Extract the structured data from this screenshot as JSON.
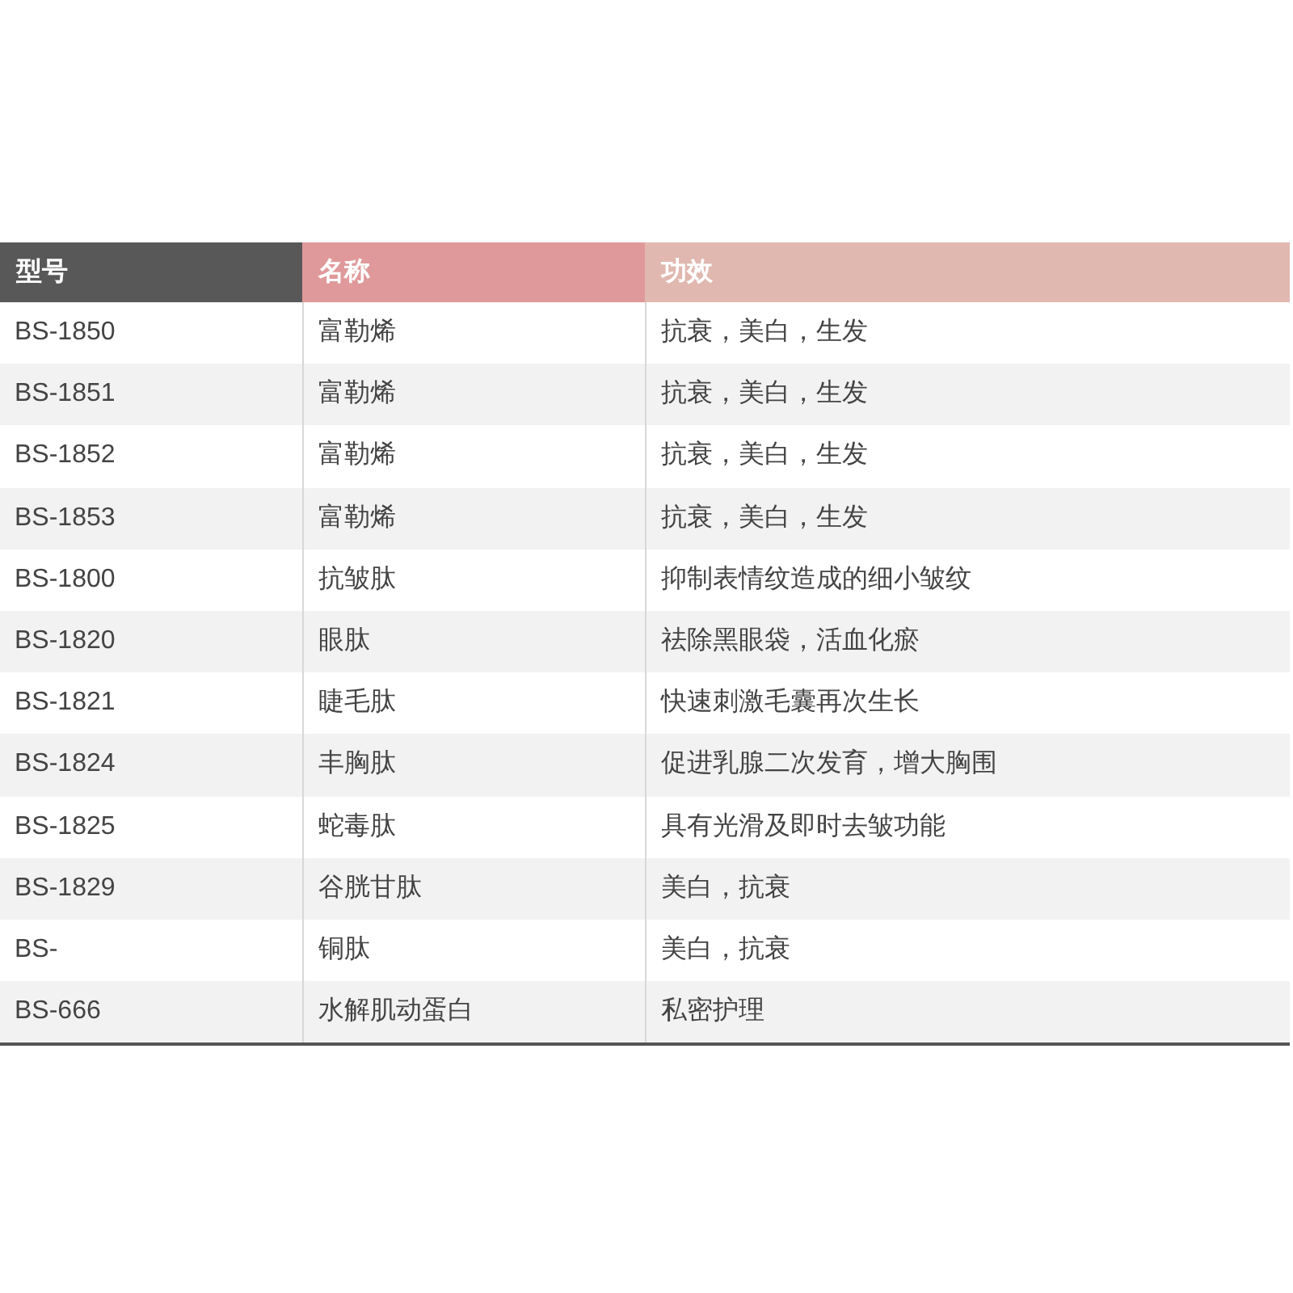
{
  "table": {
    "columns": [
      {
        "label": "型号",
        "color": "#585858"
      },
      {
        "label": "名称",
        "color": "#e0999a"
      },
      {
        "label": "功效",
        "color": "#e0b8b0"
      }
    ],
    "rows": [
      [
        "BS-1850",
        "富勒烯",
        "抗衰，美白，生发"
      ],
      [
        "BS-1851",
        "富勒烯",
        "抗衰，美白，生发"
      ],
      [
        "BS-1852",
        "富勒烯",
        "抗衰，美白，生发"
      ],
      [
        "BS-1853",
        "富勒烯",
        "抗衰，美白，生发"
      ],
      [
        "BS-1800",
        "抗皱肽",
        "抑制表情纹造成的细小皱纹"
      ],
      [
        "BS-1820",
        "眼肽",
        "祛除黑眼袋，活血化瘀"
      ],
      [
        "BS-1821",
        "睫毛肽",
        "快速刺激毛囊再次生长"
      ],
      [
        "BS-1824",
        "丰胸肽",
        "促进乳腺二次发育，增大胸围"
      ],
      [
        "BS-1825",
        "蛇毒肽",
        "具有光滑及即时去皱功能"
      ],
      [
        "BS-1829",
        "谷胱甘肽",
        "美白，抗衰"
      ],
      [
        "BS-",
        "铜肽",
        "美白，抗衰"
      ],
      [
        "BS-666",
        "水解肌动蛋白",
        "私密护理"
      ]
    ]
  }
}
